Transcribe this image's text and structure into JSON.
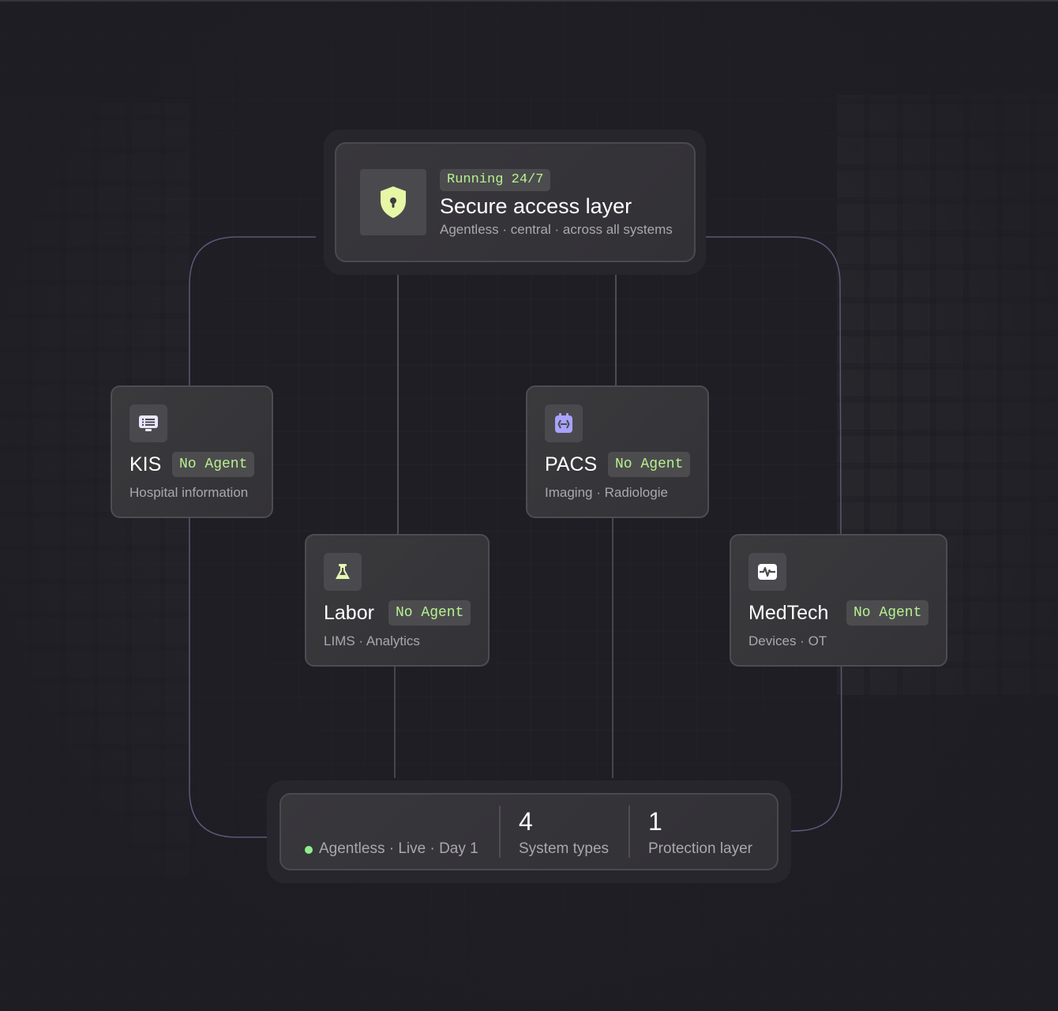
{
  "hub": {
    "status_badge": "Running 24/7",
    "title": "Secure access layer",
    "subtitle": "Agentless · central · across all systems",
    "icon": "shield-lock-icon"
  },
  "nodes": [
    {
      "title": "KIS",
      "badge": "No Agent",
      "subtitle": "Hospital information",
      "icon": "monitor-list-icon",
      "icon_color": "#e9e6ff"
    },
    {
      "title": "PACS",
      "badge": "No Agent",
      "subtitle": "Imaging · Radiologie",
      "icon": "imaging-scan-icon",
      "icon_color": "#a7a3ff"
    },
    {
      "title": "Labor",
      "badge": "No Agent",
      "subtitle": "LIMS · Analytics",
      "icon": "flask-icon",
      "icon_color": "#e6f7b3"
    },
    {
      "title": "MedTech",
      "badge": "No Agent",
      "subtitle": "Devices · OT",
      "icon": "heartbeat-icon",
      "icon_color": "#ffffff"
    }
  ],
  "stats": {
    "status": "Agentless · Live · Day 1",
    "items": [
      {
        "value": "4",
        "label": "System types"
      },
      {
        "value": "1",
        "label": "Protection layer"
      }
    ]
  },
  "colors": {
    "accent_green": "#b7f28f",
    "status_dot": "#8ef08a",
    "outer_wire": "#5a5878",
    "inner_wire": "#5e5d63"
  }
}
